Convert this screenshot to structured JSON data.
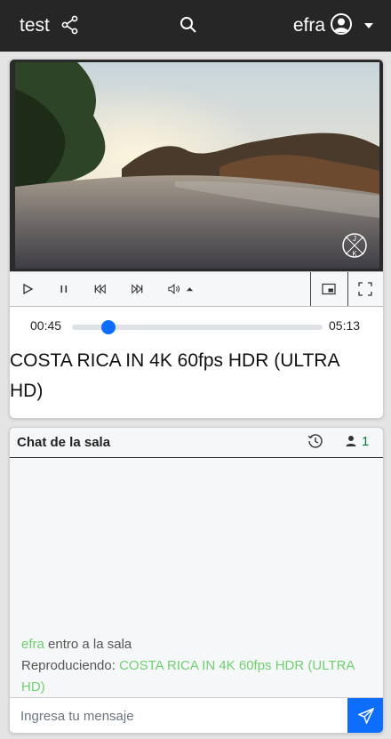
{
  "topbar": {
    "room_name": "test",
    "user_name": "efra",
    "icons": {
      "share": "share-icon",
      "search": "search-icon",
      "user": "user-circle-icon",
      "caret": "caret-down-icon"
    }
  },
  "player": {
    "controls": [
      "play",
      "pause",
      "skip-back",
      "skip-forward",
      "volume",
      "volume-menu",
      "picture-in-picture",
      "fullscreen"
    ],
    "current_time": "00:45",
    "duration": "05:13",
    "progress_fraction": 0.144,
    "title": "COSTA RICA IN 4K 60fps HDR (ULTRA HD)",
    "watermark": "J K"
  },
  "chat": {
    "title": "Chat de la sala",
    "user_count": "1",
    "messages": [
      {
        "user": "efra",
        "text": "entro a la sala"
      },
      {
        "prefix": "Reproduciendo:",
        "highlight": "COSTA RICA IN 4K 60fps HDR (ULTRA HD)"
      }
    ],
    "input_placeholder": "Ingresa tu mensaje"
  },
  "colors": {
    "topbar": "#262626",
    "accent": "#0d6efd",
    "chat_green": "#6fd06f",
    "count_green": "#0a7a3c"
  }
}
